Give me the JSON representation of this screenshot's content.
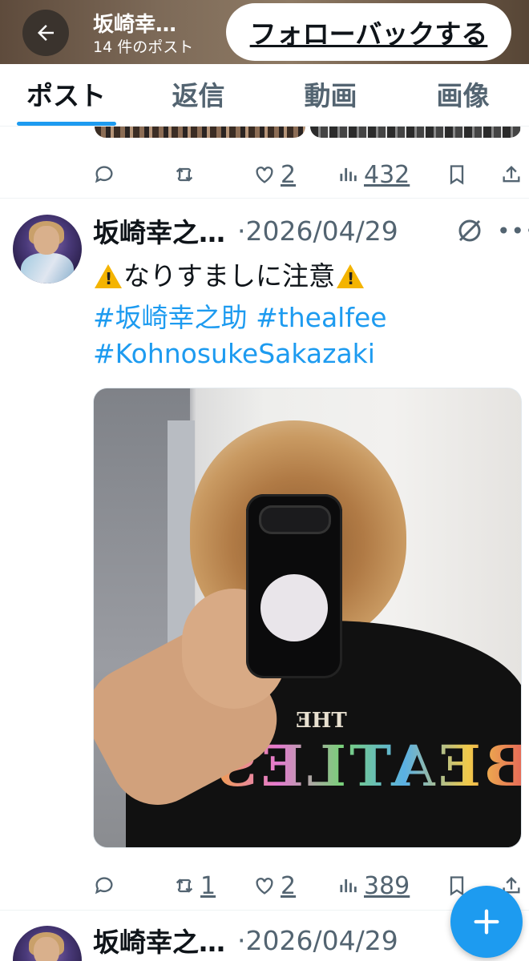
{
  "header": {
    "display_name": "坂崎幸…",
    "post_count": "14 件のポスト",
    "follow_back_label": "フォローバックする"
  },
  "tabs": [
    {
      "label": "ポスト",
      "active": true
    },
    {
      "label": "返信",
      "active": false
    },
    {
      "label": "動画",
      "active": false
    },
    {
      "label": "画像",
      "active": false
    }
  ],
  "previous_post": {
    "actions": {
      "reply": "",
      "repost": "",
      "like": "2",
      "views": "432"
    }
  },
  "post": {
    "author": "坂崎幸之…",
    "date": "·2026/04/29",
    "text_warning": "なりすましに注意",
    "hashtags_line1": "#坂崎幸之助 #thealfee",
    "hashtags_line2": "#KohnosukeSakazaki",
    "actions": {
      "reply": "",
      "repost": "1",
      "like": "2",
      "views": "389"
    }
  },
  "next_post": {
    "author": "坂崎幸之…",
    "date": "·2026/04/29"
  },
  "colors": {
    "accent": "#1d9bf0",
    "muted": "#536471",
    "text": "#0f1419"
  }
}
